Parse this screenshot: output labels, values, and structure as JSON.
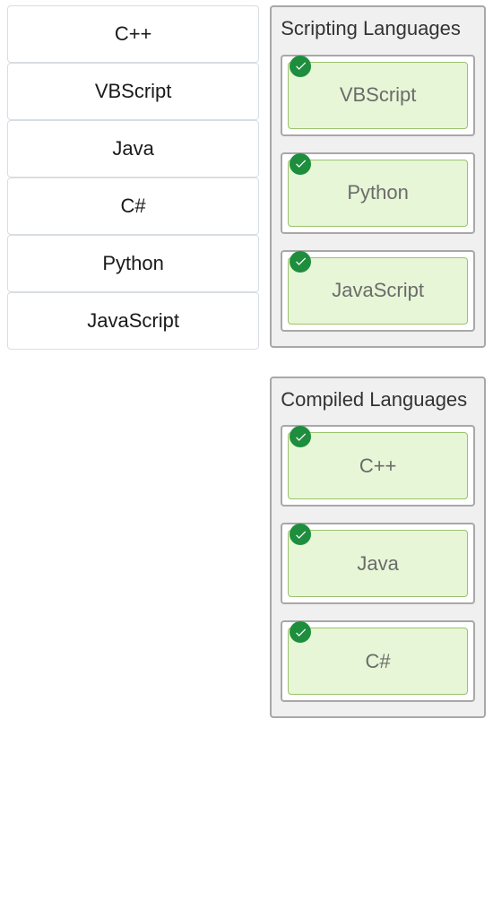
{
  "source": {
    "items": [
      "C++",
      "VBScript",
      "Java",
      "C#",
      "Python",
      "JavaScript"
    ]
  },
  "zones": [
    {
      "title": "Scripting Languages",
      "items": [
        "VBScript",
        "Python",
        "JavaScript"
      ]
    },
    {
      "title": "Compiled Languages",
      "items": [
        "C++",
        "Java",
        "C#"
      ]
    }
  ],
  "icons": {
    "check": "check"
  }
}
